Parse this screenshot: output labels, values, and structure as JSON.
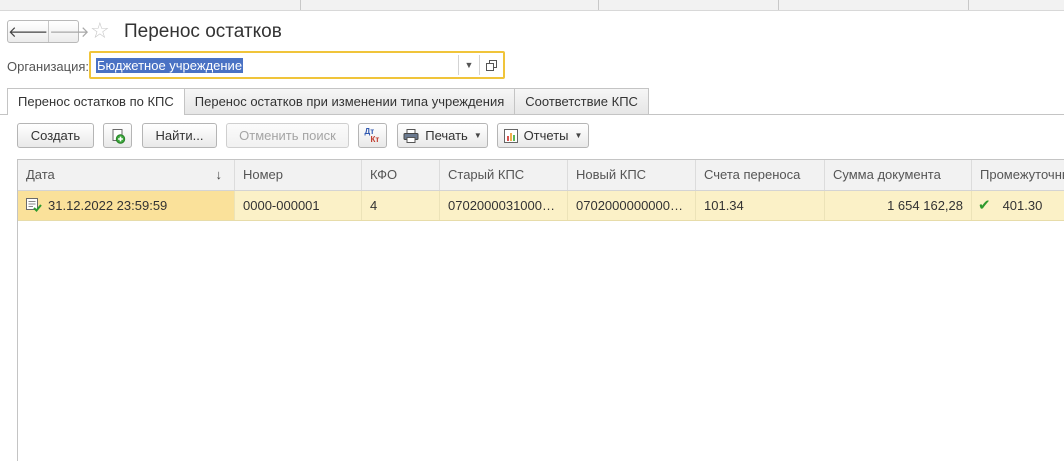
{
  "window": {
    "title": "Перенос остатков"
  },
  "nav": {
    "back_glyph": "🡐",
    "forward_glyph": "🡒",
    "favorite_glyph": "☆"
  },
  "organization": {
    "label": "Организация:",
    "value": "Бюджетное учреждение"
  },
  "tabs": [
    {
      "label": "Перенос остатков по КПС",
      "active": true
    },
    {
      "label": "Перенос остатков при изменении типа учреждения",
      "active": false
    },
    {
      "label": "Соответствие КПС",
      "active": false
    }
  ],
  "toolbar": {
    "create_label": "Создать",
    "find_label": "Найти...",
    "cancel_search_label": "Отменить поиск",
    "dtkt_top": "Дт",
    "dtkt_bottom": "Кт",
    "print_label": "Печать",
    "reports_label": "Отчеты"
  },
  "table": {
    "columns": [
      "Дата",
      "Номер",
      "КФО",
      "Старый КПС",
      "Новый КПС",
      "Счета переноса",
      "Сумма документа",
      "Промежуточны"
    ],
    "sort_glyph": "↓",
    "rows": [
      {
        "date": "31.12.2022 23:59:59",
        "number": "0000-000001",
        "kfo": "4",
        "old_kps": "07020000310000...",
        "new_kps": "07020000000000...",
        "accounts": "101.34",
        "amount": "1 654 162,28",
        "check": "✔",
        "intermediate": "401.30"
      }
    ]
  },
  "colors": {
    "accent_border": "#f0c43a",
    "selection": "#4a72c4",
    "row_highlight": "#fbf1c7",
    "check_green": "#2e9a2e"
  }
}
